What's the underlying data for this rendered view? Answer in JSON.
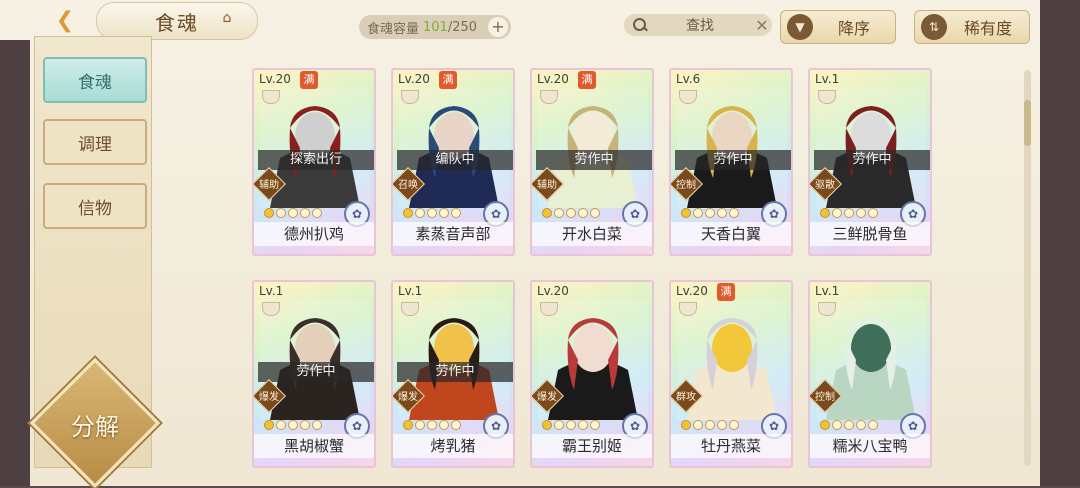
{
  "top": {
    "title": "食魂",
    "capacity_label": "食魂容量",
    "capacity_current": "101",
    "capacity_max": "/250",
    "search_label": "查找",
    "sort_label": "降序",
    "rarity_label": "稀有度"
  },
  "sidebar": {
    "tabs": [
      {
        "label": "食魂"
      },
      {
        "label": "调理"
      },
      {
        "label": "信物"
      }
    ],
    "decompose_label": "分解"
  },
  "cards": [
    {
      "level": "Lv.20",
      "full": "满",
      "status": "探索出行",
      "role": "辅助",
      "stars": 1,
      "name": "德州扒鸡",
      "palette": [
        "#3a3a3a",
        "#cfcfcf",
        "#8a1f1f"
      ]
    },
    {
      "level": "Lv.20",
      "full": "满",
      "status": "编队中",
      "role": "召唤",
      "stars": 1,
      "name": "素蒸音声部",
      "palette": [
        "#1f2a55",
        "#e8d5c7",
        "#2a4a7a"
      ]
    },
    {
      "level": "Lv.20",
      "full": "满",
      "status": "劳作中",
      "role": "辅助",
      "stars": 1,
      "name": "开水白菜",
      "palette": [
        "#e8f0d4",
        "#f4ead8",
        "#c7b27a"
      ]
    },
    {
      "level": "Lv.6",
      "full": "",
      "status": "劳作中",
      "role": "控制",
      "stars": 1,
      "name": "天香白翼",
      "palette": [
        "#1a1a1a",
        "#e9d7c4",
        "#d7b34a"
      ]
    },
    {
      "level": "Lv.1",
      "full": "",
      "status": "劳作中",
      "role": "驱散",
      "stars": 1,
      "name": "三鲜脱骨鱼",
      "palette": [
        "#2a2a2a",
        "#dcdcdc",
        "#7a2020"
      ]
    },
    {
      "level": "Lv.1",
      "full": "",
      "status": "劳作中",
      "role": "爆发",
      "stars": 1,
      "name": "黑胡椒蟹",
      "palette": [
        "#2b2320",
        "#e4cfbb",
        "#3a2f2a"
      ]
    },
    {
      "level": "Lv.1",
      "full": "",
      "status": "劳作中",
      "role": "爆发",
      "stars": 1,
      "name": "烤乳猪",
      "palette": [
        "#c0461e",
        "#f0c24a",
        "#2a1a12"
      ]
    },
    {
      "level": "Lv.20",
      "full": "",
      "status": "",
      "role": "爆发",
      "stars": 1,
      "name": "霸王别姬",
      "palette": [
        "#1a1a1a",
        "#f0dcd0",
        "#b83a3a"
      ]
    },
    {
      "level": "Lv.20",
      "full": "满",
      "status": "",
      "role": "群攻",
      "stars": 1,
      "name": "牡丹燕菜",
      "palette": [
        "#f4e7d0",
        "#f3c73a",
        "#d6d0d8"
      ]
    },
    {
      "level": "Lv.1",
      "full": "",
      "status": "",
      "role": "控制",
      "stars": 1,
      "name": "糯米八宝鸭",
      "palette": [
        "#b9d6c2",
        "#3f6e5a",
        "#e6efe7"
      ]
    }
  ]
}
